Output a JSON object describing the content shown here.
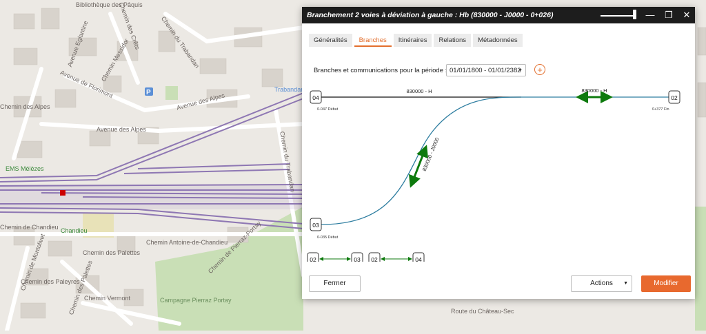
{
  "map": {
    "street_labels": [
      "Bibliothèque des Pâquis",
      "Chemin des Crêts",
      "Avenue Eglantine",
      "Chemin Messidor",
      "Chemin du Trabandan",
      "Avenue de Florimont",
      "Avenue des Alpes",
      "Avenue des Alpes",
      "Trabandan",
      "Chemin de Chandieu",
      "EMS Mélèzes",
      "Chandieu",
      "Chemin Antoine-de-Chandieu",
      "Chemin de Montolivet",
      "Chemin des Palettes",
      "Chemin des Paleyres",
      "Chemin Vermont",
      "Chemin des Palettes",
      "Campagne Pierraz Portay",
      "Chemin de Pierraz-Portay",
      "Route du Château-Sec",
      "Chemin du Trabandan",
      "Chemin des Alpes"
    ],
    "colors": {
      "background": "#ece9e4",
      "rail": "#8e77b3",
      "park": "#c9dfb6"
    }
  },
  "dialog": {
    "title": "Branchement 2 voies à déviation à gauche : Hb (830000 - J0000 - 0+026)",
    "window_controls": {
      "minimize": "—",
      "restore": "❐",
      "close": "✕"
    },
    "tabs": [
      {
        "label": "Généralités",
        "active": false
      },
      {
        "label": "Branches",
        "active": true
      },
      {
        "label": "Itinéraires",
        "active": false
      },
      {
        "label": "Relations",
        "active": false
      },
      {
        "label": "Métadonnées",
        "active": false
      }
    ],
    "period_label": "Branches et communications pour la période :",
    "period_value": "01/01/1800 - 01/01/2382",
    "add_icon": "+",
    "diagram": {
      "nodes": [
        {
          "id": "04",
          "sublabel": "0-047 Début"
        },
        {
          "id": "02",
          "sublabel": "0+377 Fin"
        },
        {
          "id": "03",
          "sublabel": "0-035 Début"
        }
      ],
      "branch_labels": [
        "830000 - H",
        "830000 - H",
        "830000 - J0000"
      ],
      "communications": [
        {
          "from": "02",
          "to": "03"
        },
        {
          "from": "02",
          "to": "04"
        }
      ],
      "colors": {
        "track_main": "#111111",
        "track_branch": "#2d7da0",
        "arrow": "#0d7a0d"
      }
    },
    "buttons": {
      "close": "Fermer",
      "actions": "Actions",
      "modify": "Modifier"
    },
    "accent_color": "#e36e2c"
  }
}
